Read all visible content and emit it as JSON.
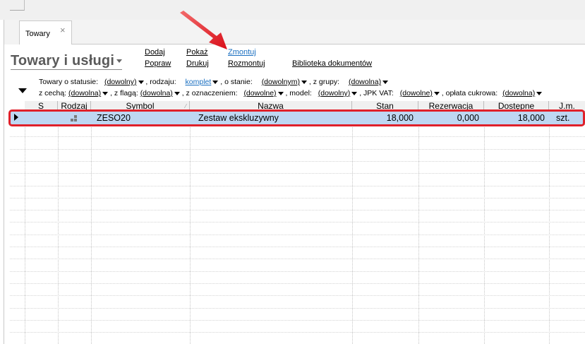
{
  "tab": {
    "label": "Towary",
    "close": "×"
  },
  "title": "Towary i usługi",
  "actions": {
    "add": "Dodaj",
    "show": "Pokaż",
    "assemble": "Zmontuj",
    "edit": "Popraw",
    "print": "Drukuj",
    "disassemble": "Rozmontuj",
    "docs": "Biblioteka dokumentów"
  },
  "filters": {
    "status_label": "Towary o statusie:",
    "status_value": "(dowolny)",
    "kind_label": ", rodzaju:",
    "kind_value": "komplet",
    "state_label": ", o stanie:",
    "state_value": "(dowolnym)",
    "group_label": ", z grupy:",
    "group_value": "(dowolna)",
    "feature_label": "z cechą:",
    "feature_value": "(dowolna)",
    "flag_label": ", z flagą:",
    "flag_value": "(dowolna)",
    "mark_label": ", z oznaczeniem:",
    "mark_value": "(dowolne)",
    "model_label": ", model:",
    "model_value": "(dowolny)",
    "jpk_label": ", JPK VAT:",
    "jpk_value": "(dowolne)",
    "sugar_label": ", opłata cukrowa:",
    "sugar_value": "(dowolna)"
  },
  "columns": {
    "s": "S",
    "kind": "Rodzaj",
    "symbol": "Symbol",
    "name": "Nazwa",
    "stock": "Stan",
    "reserved": "Rezerwacja",
    "available": "Dostępne",
    "unit": "J.m."
  },
  "rows": [
    {
      "symbol": "ZESO20",
      "name": "Zestaw ekskluzywny",
      "stock": "18,000",
      "reserved": "0,000",
      "available": "18,000",
      "unit": "szt."
    }
  ],
  "colors": {
    "selection": "#bed7f2",
    "highlight": "#e0202a",
    "link": "#1a6fc0"
  }
}
